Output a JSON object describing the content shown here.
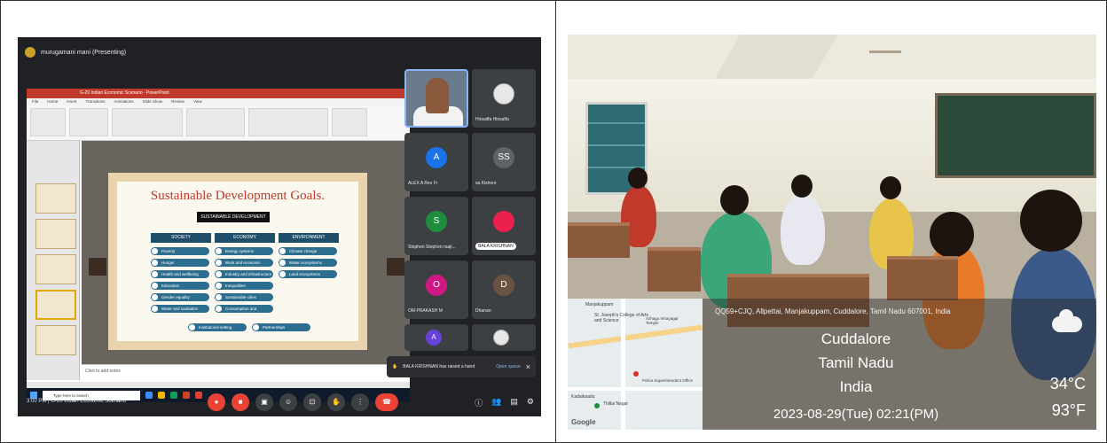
{
  "meeting": {
    "presenter_label": "murugamani mani (Presenting)",
    "time_and_title": "3:00 PM  |  G-20 Indian Economic Scenario",
    "toast_text": "BALA KRISHNAN has raised a hand",
    "toast_action": "Open queue",
    "participants": [
      {
        "name": "Hinsaffa Hinsaffa",
        "type": "photo"
      },
      {
        "name": "ALEX A Rev Fr",
        "initial": "A",
        "color": "#1a73e8"
      },
      {
        "name": "sa Kishore",
        "initial": "SS",
        "color": "#5f6368"
      },
      {
        "name": "Stephen Stephen raaji...",
        "initial": "S",
        "color": "#1e8e3e"
      },
      {
        "name": "BALA KRISHNAN",
        "initial": "",
        "color": "#ea1f4e"
      },
      {
        "name": "OM PRAKASH M",
        "initial": "O",
        "color": "#d01884"
      },
      {
        "name": "Dhanan",
        "initial": "D",
        "color": "#6b5242"
      },
      {
        "name": "",
        "initial": "A",
        "color": "#6741d9"
      },
      {
        "name": "",
        "type": "photo"
      }
    ]
  },
  "powerpoint": {
    "window_title": "G-20 Indian Economic Scenario - PowerPoint",
    "tabs": [
      "File",
      "Home",
      "Insert",
      "Transitions",
      "Animations",
      "Slide Show",
      "Review",
      "View"
    ],
    "notes_placeholder": "Click to add notes",
    "taskbar_search": "Type here to search",
    "slide": {
      "title": "Sustainable Development Goals.",
      "root": "SUSTAINABLE DEVELOPMENT",
      "columns": [
        {
          "head": "SOCIETY",
          "goals": [
            "Poverty",
            "Hunger",
            "Health and wellbeing",
            "Education",
            "Gender equality",
            "Water and sanitation"
          ]
        },
        {
          "head": "ECONOMY",
          "goals": [
            "Energy systems",
            "Work and economic growth",
            "Industry and infrastructure",
            "Inequalities",
            "Sustainable cities",
            "Consumption and production"
          ]
        },
        {
          "head": "ENVIRONMENT",
          "goals": [
            "Climate change",
            "Water ecosystems",
            "Land ecosystems"
          ]
        }
      ],
      "bottom_goals": [
        "Institutional setting",
        "Partnerships"
      ]
    }
  },
  "geotag": {
    "address": "QQ59+CJQ, Allpettai, Manjakuppam, Cuddalore, Tamil Nadu 607001, India",
    "city": "Cuddalore",
    "state": "Tamil Nadu",
    "country": "India",
    "datetime": "2023-08-29(Tue)   02:21(PM)",
    "temp_c": "34°C",
    "temp_f": "93°F",
    "map_brand": "Google",
    "map_labels": [
      "Manjakuppam",
      "St. Joseph's College of Arts and Science",
      "Azhagu Vinayagar Temple",
      "Police Superintendent Office",
      "Kadaikaadu",
      "Thillai Nagar"
    ]
  }
}
